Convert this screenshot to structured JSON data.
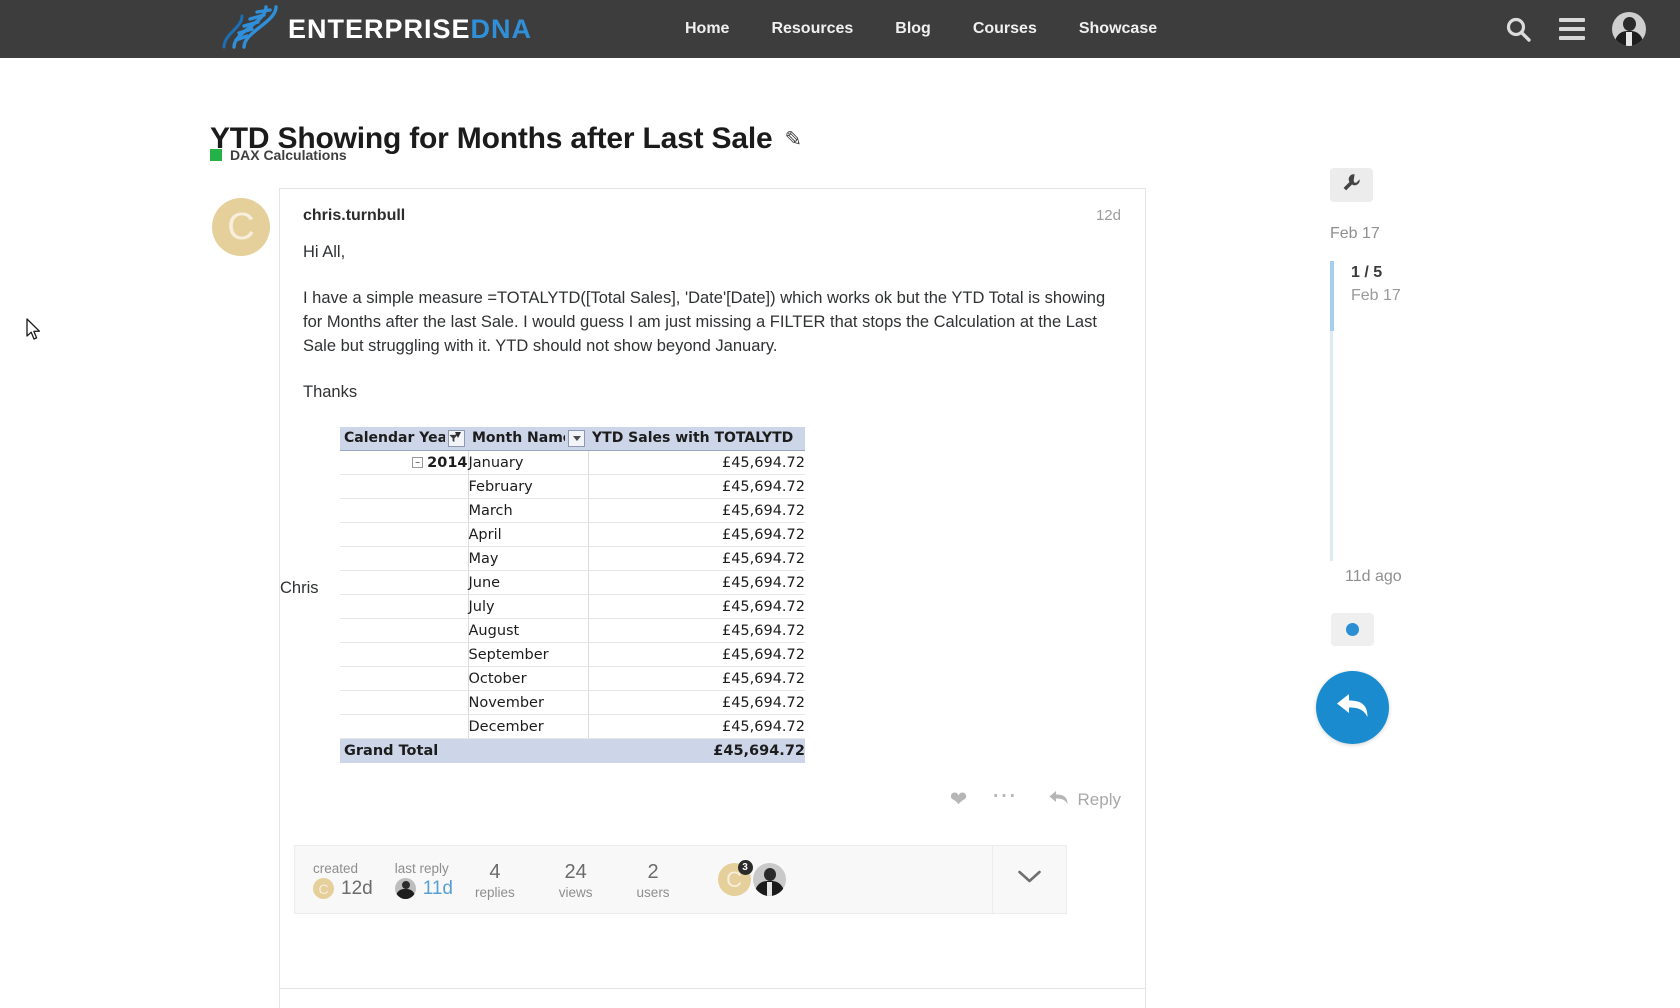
{
  "nav": {
    "brand_primary": "ENTERPRISE",
    "brand_secondary": "DNA",
    "logo_icon": "dna-helix-icon",
    "links": [
      {
        "label": "Home"
      },
      {
        "label": "Resources"
      },
      {
        "label": "Blog"
      },
      {
        "label": "Courses"
      },
      {
        "label": "Showcase"
      }
    ],
    "search_icon": "search-icon",
    "menu_icon": "hamburger-menu-icon",
    "avatar_icon": "user-avatar"
  },
  "topic": {
    "title": "YTD Showing for Months after Last Sale",
    "edit_icon": "pencil-icon",
    "category": "DAX Calculations",
    "category_color": "#25b349"
  },
  "post": {
    "avatar_letter": "C",
    "username": "chris.turnbull",
    "date": "12d",
    "paragraphs": [
      "Hi All,",
      "I have a simple measure =TOTALYTD([Total Sales], 'Date'[Date]) which works ok but the YTD Total is showing for Months after the last Sale. I would guess I am just missing a FILTER that stops the Calculation at the Last Sale but struggling with it. YTD should not show beyond January.",
      "Thanks",
      "Chris"
    ],
    "actions": {
      "like_icon": "heart-icon",
      "more_icon": "ellipsis-icon",
      "reply_icon": "reply-arrow-icon",
      "reply_label": "Reply"
    }
  },
  "table": {
    "headers": [
      "Calendar Yea",
      "Month Name",
      "YTD Sales with TOTALYTD"
    ],
    "year": "2014",
    "expander": "–",
    "rows": [
      {
        "month": "January",
        "ytd": "£45,694.72"
      },
      {
        "month": "February",
        "ytd": "£45,694.72"
      },
      {
        "month": "March",
        "ytd": "£45,694.72"
      },
      {
        "month": "April",
        "ytd": "£45,694.72"
      },
      {
        "month": "May",
        "ytd": "£45,694.72"
      },
      {
        "month": "June",
        "ytd": "£45,694.72"
      },
      {
        "month": "July",
        "ytd": "£45,694.72"
      },
      {
        "month": "August",
        "ytd": "£45,694.72"
      },
      {
        "month": "September",
        "ytd": "£45,694.72"
      },
      {
        "month": "October",
        "ytd": "£45,694.72"
      },
      {
        "month": "November",
        "ytd": "£45,694.72"
      },
      {
        "month": "December",
        "ytd": "£45,694.72"
      }
    ],
    "grand_total_label": "Grand Total",
    "grand_total_value": "£45,694.72"
  },
  "stats": {
    "created_label": "created",
    "created_value": "12d",
    "created_avatar_letter": "C",
    "last_reply_label": "last reply",
    "last_reply_value": "11d",
    "replies_value": "4",
    "replies_label": "replies",
    "views_value": "24",
    "views_label": "views",
    "users_value": "2",
    "users_label": "users",
    "poster_letter": "C",
    "poster_badge": "3",
    "expand_icon": "chevron-down-icon"
  },
  "timeline": {
    "wrench_icon": "wrench-icon",
    "top_date": "Feb 17",
    "position": "1 / 5",
    "position_date": "Feb 17",
    "last_post": "11d ago",
    "jump_icon": "dot-icon",
    "reply_fab_icon": "reply-arrow-icon"
  },
  "cursor": {
    "icon": "mouse-pointer"
  }
}
